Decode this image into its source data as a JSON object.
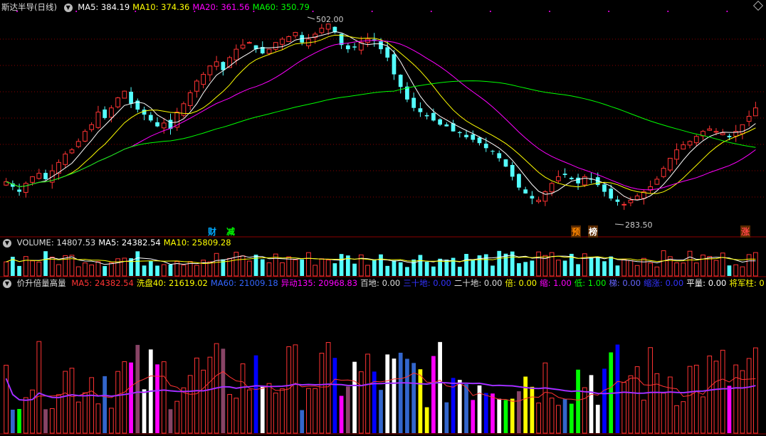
{
  "header": {
    "title": "斯达半导(日线)",
    "ma_items": [
      {
        "label": "MA5: 384.19",
        "color": "#ffffff"
      },
      {
        "label": "MA10: 374.36",
        "color": "#ffff00"
      },
      {
        "label": "MA20: 361.56",
        "color": "#ff00ff"
      },
      {
        "label": "MA60: 350.79",
        "color": "#00ff00"
      }
    ]
  },
  "annotations": {
    "high_label": "502.00",
    "low_label": "283.50"
  },
  "events": [
    {
      "label": "财",
      "color": "#00aaff",
      "boxed": false
    },
    {
      "label": "减",
      "color": "#00ff00",
      "boxed": false
    },
    {
      "label": "预",
      "color": "#ff8800",
      "boxed": true
    },
    {
      "label": "榜",
      "color": "#ffffff",
      "boxed": true
    },
    {
      "label": "涨",
      "color": "#ff4444",
      "boxed": true
    }
  ],
  "volume_header": {
    "items": [
      {
        "label": "VOLUME: 14807.53",
        "color": "#dddddd"
      },
      {
        "label": "MA5: 24382.54",
        "color": "#ffffff"
      },
      {
        "label": "MA10: 25809.28",
        "color": "#ffff00"
      }
    ]
  },
  "indicator_header": {
    "title": "价升倍量高量",
    "items": [
      {
        "label": "MA5: 24382.54",
        "color": "#ff3333"
      },
      {
        "label": "洗盘40: 21619.02",
        "color": "#ffff00"
      },
      {
        "label": "MA60: 21009.18",
        "color": "#3366ff"
      },
      {
        "label": "异动135: 20968.83",
        "color": "#ff00ff"
      },
      {
        "label": "百地: 0.00",
        "color": "#dddddd"
      },
      {
        "label": "三十地: 0.00",
        "color": "#3333ff"
      },
      {
        "label": "二十地: 0.00",
        "color": "#dddddd"
      },
      {
        "label": "倍: 0.00",
        "color": "#ffff00"
      },
      {
        "label": "缩: 1.00",
        "color": "#ff00ff"
      },
      {
        "label": "低: 1.00",
        "color": "#00ff00"
      },
      {
        "label": "梯: 0.00",
        "color": "#6666ff"
      },
      {
        "label": "缩涨: 0.00",
        "color": "#3333ff"
      },
      {
        "label": "平量: 0.00",
        "color": "#ffffff"
      },
      {
        "label": "将军柱: 0",
        "color": "#ffff00"
      }
    ]
  },
  "colors": {
    "up": "#ff3333",
    "down": "#54ffff",
    "ma5": "#ffffff",
    "ma10": "#ffff00",
    "ma20": "#ff00ff",
    "ma60": "#00ff00",
    "grid": "#8b0000"
  },
  "chart_data": {
    "type": "candlestick",
    "price_range": [
      270,
      510
    ],
    "high": 502.0,
    "low": 283.5,
    "close_series": [
      312,
      306,
      300,
      310,
      318,
      322,
      315,
      325,
      335,
      345,
      350,
      360,
      372,
      380,
      395,
      388,
      400,
      412,
      420,
      405,
      398,
      392,
      385,
      378,
      382,
      375,
      395,
      405,
      418,
      432,
      440,
      450,
      455,
      445,
      460,
      470,
      475,
      478,
      470,
      465,
      470,
      478,
      482,
      485,
      490,
      478,
      482,
      488,
      495,
      500,
      490,
      475,
      470,
      472,
      478,
      482,
      480,
      470,
      460,
      440,
      425,
      410,
      400,
      395,
      390,
      385,
      380,
      378,
      372,
      370,
      365,
      362,
      358,
      352,
      348,
      340,
      330,
      318,
      305,
      298,
      292,
      290,
      300,
      310,
      318,
      320,
      315,
      310,
      318,
      315,
      308,
      300,
      292,
      288,
      285,
      290,
      295,
      300,
      306,
      315,
      328,
      340,
      350,
      356,
      360,
      366,
      372,
      375,
      372,
      370,
      365,
      372,
      380,
      390,
      400
    ]
  }
}
